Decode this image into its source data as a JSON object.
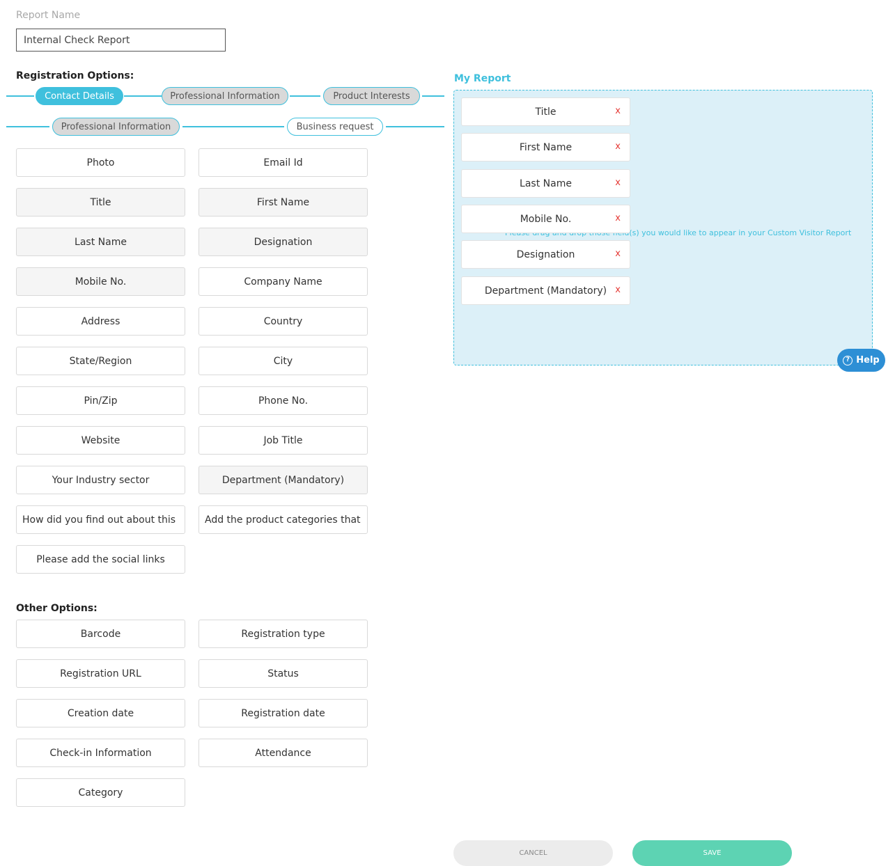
{
  "report_name": {
    "label": "Report Name",
    "value": "Internal Check Report"
  },
  "registration_options": {
    "title": "Registration Options:",
    "tabs": [
      {
        "label": "Contact Details",
        "state": "active"
      },
      {
        "label": "Professional Information",
        "state": "visited"
      },
      {
        "label": "Product Interests",
        "state": "visited"
      },
      {
        "label": "Professional Information",
        "state": "visited"
      },
      {
        "label": "Business request",
        "state": "default"
      }
    ],
    "fields": [
      {
        "label": "Photo",
        "selected": false
      },
      {
        "label": "Email Id",
        "selected": false
      },
      {
        "label": "Title",
        "selected": true
      },
      {
        "label": "First Name",
        "selected": true
      },
      {
        "label": "Last Name",
        "selected": true
      },
      {
        "label": "Designation",
        "selected": true
      },
      {
        "label": "Mobile No.",
        "selected": true
      },
      {
        "label": "Company Name",
        "selected": false
      },
      {
        "label": "Address",
        "selected": false
      },
      {
        "label": "Country",
        "selected": false
      },
      {
        "label": "State/Region",
        "selected": false
      },
      {
        "label": "City",
        "selected": false
      },
      {
        "label": "Pin/Zip",
        "selected": false
      },
      {
        "label": "Phone No.",
        "selected": false
      },
      {
        "label": "Website",
        "selected": false
      },
      {
        "label": "Job Title",
        "selected": false
      },
      {
        "label": "Your Industry sector",
        "selected": false
      },
      {
        "label": "Department (Mandatory)",
        "selected": true
      },
      {
        "label": "How did you find out about this",
        "selected": false
      },
      {
        "label": "Add the product categories that",
        "selected": false
      },
      {
        "label": "Please add the social links",
        "selected": false
      }
    ]
  },
  "other_options": {
    "title": "Other Options:",
    "fields": [
      "Barcode",
      "Registration type",
      "Registration URL",
      "Status",
      "Creation date",
      "Registration date",
      "Check-in Information",
      "Attendance",
      "Category"
    ]
  },
  "my_report": {
    "title": "My Report",
    "hint": "Please drag and drop those field(s) you would like to appear in your Custom Visitor Report",
    "remove_symbol": "x",
    "items": [
      "Title",
      "First Name",
      "Last Name",
      "Mobile No.",
      "Designation",
      "Department (Mandatory)"
    ]
  },
  "help": {
    "label": "Help",
    "icon": "?"
  },
  "actions": {
    "cancel": "CANCEL",
    "save": "SAVE"
  },
  "colors": {
    "accent": "#3fc0dd",
    "save": "#5dd3b3",
    "help": "#2d8fd5",
    "remove": "#e53935",
    "drop_bg": "#dcf0f8"
  }
}
